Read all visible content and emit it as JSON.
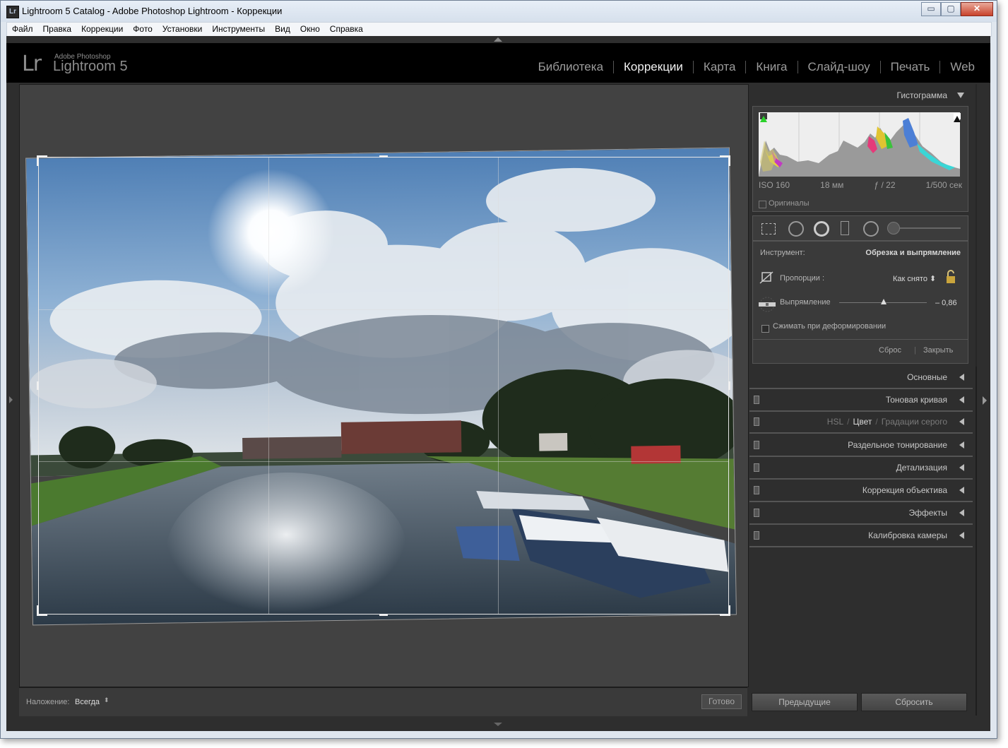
{
  "window": {
    "title": "Lightroom 5 Catalog - Adobe Photoshop Lightroom - Коррекции",
    "icon_label": "Lr",
    "btn_minimize": "▭",
    "btn_maximize": "▢",
    "btn_close": "✕"
  },
  "menu": [
    "Файл",
    "Правка",
    "Коррекции",
    "Фото",
    "Установки",
    "Инструменты",
    "Вид",
    "Окно",
    "Справка"
  ],
  "identity": {
    "logo": "Lr",
    "brand_top": "Adobe Photoshop",
    "brand_main": "Lightroom 5"
  },
  "modules": [
    {
      "label": "Библиотека",
      "active": false
    },
    {
      "label": "Коррекции",
      "active": true
    },
    {
      "label": "Карта",
      "active": false
    },
    {
      "label": "Книга",
      "active": false
    },
    {
      "label": "Слайд-шоу",
      "active": false
    },
    {
      "label": "Печать",
      "active": false
    },
    {
      "label": "Web",
      "active": false
    }
  ],
  "toolbar": {
    "overlay_label": "Наложение:",
    "overlay_value": "Всегда",
    "overlay_arrows": "⬍",
    "done_label": "Готово"
  },
  "histogram": {
    "title": "Гистограмма",
    "iso": "ISO 160",
    "focal": "18 мм",
    "aperture": "ƒ / 22",
    "shutter": "1/500 сек",
    "originals_label": "Оригиналы"
  },
  "crop_tool": {
    "tool_label": "Инструмент:",
    "tool_value": "Обрезка и выпрямление",
    "aspect_label": "Пропорции :",
    "aspect_value": "Как снято ⬍",
    "straighten_label": "Выпрямление",
    "straighten_value": "– 0,86",
    "constrain_label": "Сжимать при деформировании",
    "reset_label": "Сброс",
    "close_label": "Закрыть",
    "divider": "|"
  },
  "panels": {
    "basic": "Основные",
    "tone_curve": "Тоновая кривая",
    "hsl": "HSL",
    "color": "Цвет",
    "grayscale": "Градации серого",
    "hsl_sep": "/",
    "split_toning": "Раздельное тонирование",
    "detail": "Детализация",
    "lens": "Коррекция объектива",
    "effects": "Эффекты",
    "calibration": "Калибровка камеры"
  },
  "bottom": {
    "previous_label": "Предыдущие",
    "reset_label": "Сбросить"
  },
  "colors": {
    "accent": "#f2f2f2",
    "panel_bg": "#2e2e2e",
    "canvas_bg": "#424242"
  }
}
